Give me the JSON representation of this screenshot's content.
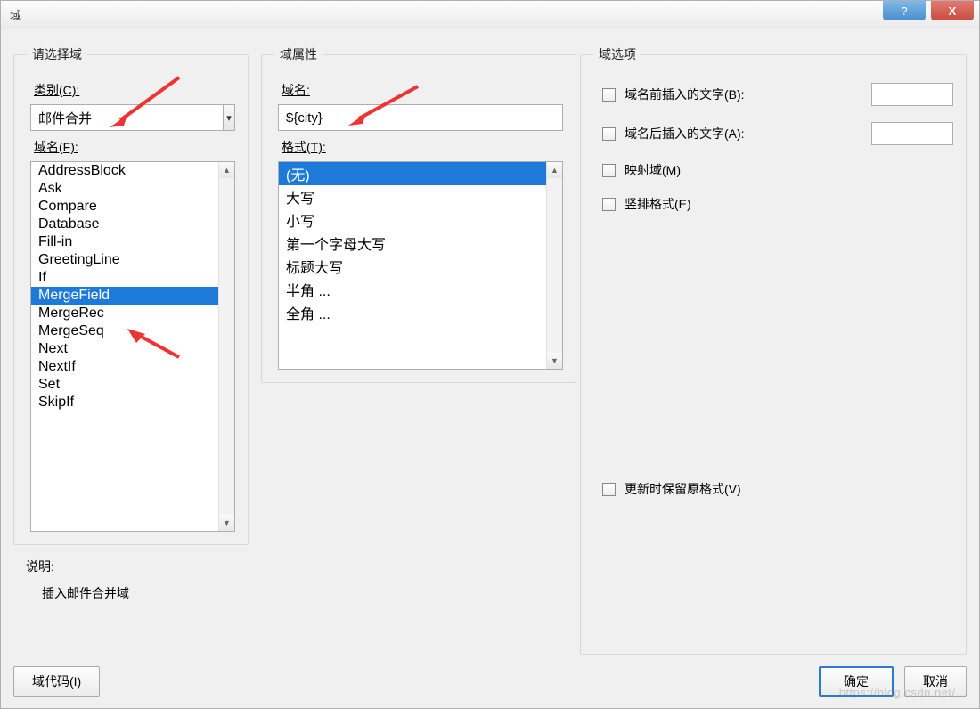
{
  "title": "域",
  "titlebar": {
    "help": "?",
    "close": "X"
  },
  "left": {
    "legend": "请选择域",
    "category_label": "类别(C):",
    "category_value": "邮件合并",
    "fieldname_label": "域名(F):",
    "fields": [
      "AddressBlock",
      "Ask",
      "Compare",
      "Database",
      "Fill-in",
      "GreetingLine",
      "If",
      "MergeField",
      "MergeRec",
      "MergeSeq",
      "Next",
      "NextIf",
      "Set",
      "SkipIf"
    ],
    "selected_field": "MergeField",
    "desc_label": "说明:",
    "desc_text": "插入邮件合并域"
  },
  "mid": {
    "legend": "域属性",
    "fieldname_label": "域名:",
    "fieldname_value": "${city}",
    "format_label": "格式(T):",
    "formats": [
      "(无)",
      "大写",
      "小写",
      "第一个字母大写",
      "标题大写",
      "半角 ...",
      "全角 ..."
    ],
    "selected_format": "(无)"
  },
  "right": {
    "legend": "域选项",
    "opt_before": "域名前插入的文字(B):",
    "opt_after": "域名后插入的文字(A):",
    "opt_map": "映射域(M)",
    "opt_vertical": "竖排格式(E)",
    "opt_keep": "更新时保留原格式(V)"
  },
  "buttons": {
    "fieldcode": "域代码(I)",
    "ok": "确定",
    "cancel": "取消"
  },
  "watermark": "https://blog.csdn.net/..."
}
